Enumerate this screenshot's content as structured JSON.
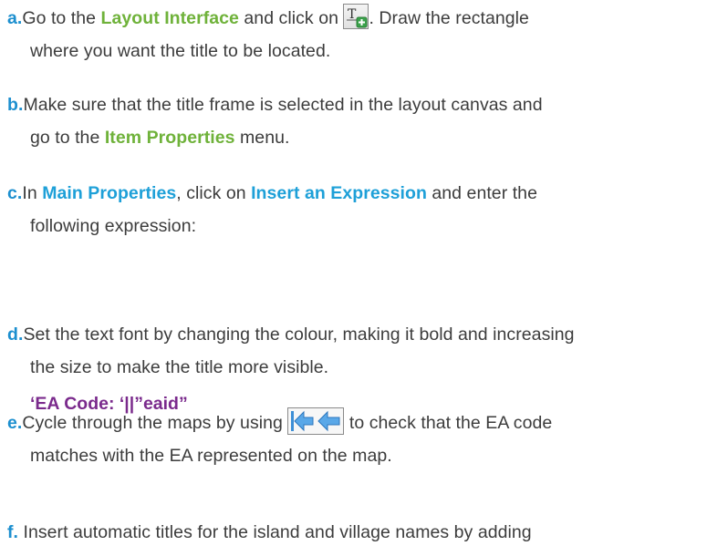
{
  "steps": [
    {
      "marker": "a.",
      "line1_pre": "Go to the",
      "line1_hl": "Layout Interface",
      "line1_mid": "and click on",
      "line1_post": ". Draw the rectangle",
      "line2": "where you want the title to be located."
    },
    {
      "marker": "b.",
      "line1": "Make sure that the title frame is selected in the layout canvas and",
      "line2_pre": "go to the",
      "line2_hl": "Item Properties",
      "line2_post": "menu."
    },
    {
      "marker": "c.",
      "line1_pre": "In",
      "line1_hl1": "Main Properties",
      "line1_mid": ", click on",
      "line1_hl2": "Insert an Expression",
      "line1_post": "and enter the",
      "line2": "following expression:"
    },
    {
      "marker": "d.",
      "line1": "Set the text font by changing the colour, making it bold and increasing",
      "line2": "the size to make the title more visible."
    },
    {
      "marker": "e.",
      "line1_pre": "Cycle through the maps by using",
      "line1_post": "to check that the EA code",
      "line2": "matches with the EA represented on the map."
    },
    {
      "marker": "f.",
      "line1": "Insert automatic titles for the island and village names by adding"
    }
  ],
  "expression": "‘EA Code: ‘||”eaid”",
  "icons": {
    "text_tool": "add-label-icon",
    "first_feature": "first-feature-icon",
    "previous_feature": "previous-feature-icon"
  },
  "colors": {
    "marker": "#1c8fcf",
    "highlight_green": "#6fb23a",
    "highlight_blue": "#1ea0d8",
    "expression": "#7a2a8c",
    "body_text": "#3c3c3c"
  }
}
